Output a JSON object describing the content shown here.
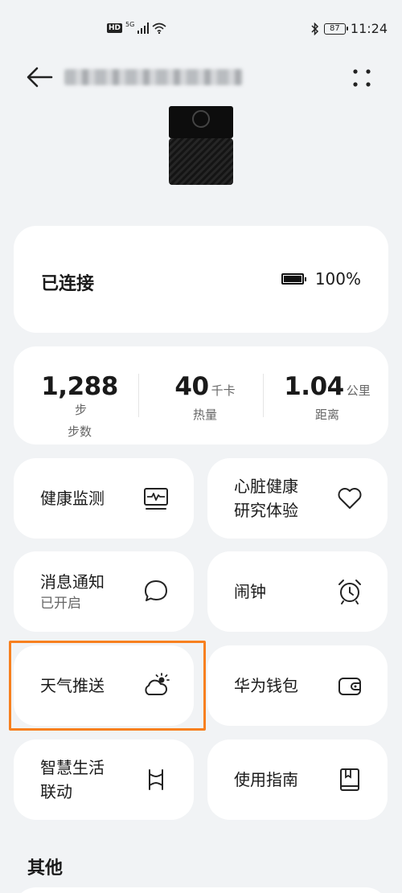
{
  "status_bar": {
    "hd": "HD",
    "network": "5G",
    "battery": "87",
    "time": "11:24"
  },
  "header": {
    "title": ""
  },
  "connection": {
    "status": "已连接",
    "battery": "100%"
  },
  "stats": [
    {
      "value": "1,288",
      "unit": "步",
      "label": "步数"
    },
    {
      "value": "40",
      "unit": "千卡",
      "label": "热量"
    },
    {
      "value": "1.04",
      "unit": "公里",
      "label": "距离"
    }
  ],
  "tiles": {
    "health_monitor": {
      "label": "健康监测",
      "icon": "heart-rate-monitor-icon"
    },
    "heart_study": {
      "label_line1": "心脏健康",
      "label_line2": "研究体验",
      "icon": "heart-icon"
    },
    "notifications": {
      "label": "消息通知",
      "sub": "已开启",
      "icon": "chat-bubble-icon"
    },
    "alarm": {
      "label": "闹钟",
      "icon": "alarm-clock-icon"
    },
    "weather": {
      "label": "天气推送",
      "icon": "weather-cloud-sun-icon"
    },
    "wallet": {
      "label": "华为钱包",
      "icon": "wallet-icon"
    },
    "smart_life": {
      "label_line1": "智慧生活",
      "label_line2": "联动",
      "icon": "smart-link-icon"
    },
    "guide": {
      "label": "使用指南",
      "icon": "book-icon"
    }
  },
  "section": {
    "others": "其他"
  },
  "colors": {
    "background": "#f1f3f5",
    "card": "#ffffff",
    "highlight": "#f7801f"
  }
}
